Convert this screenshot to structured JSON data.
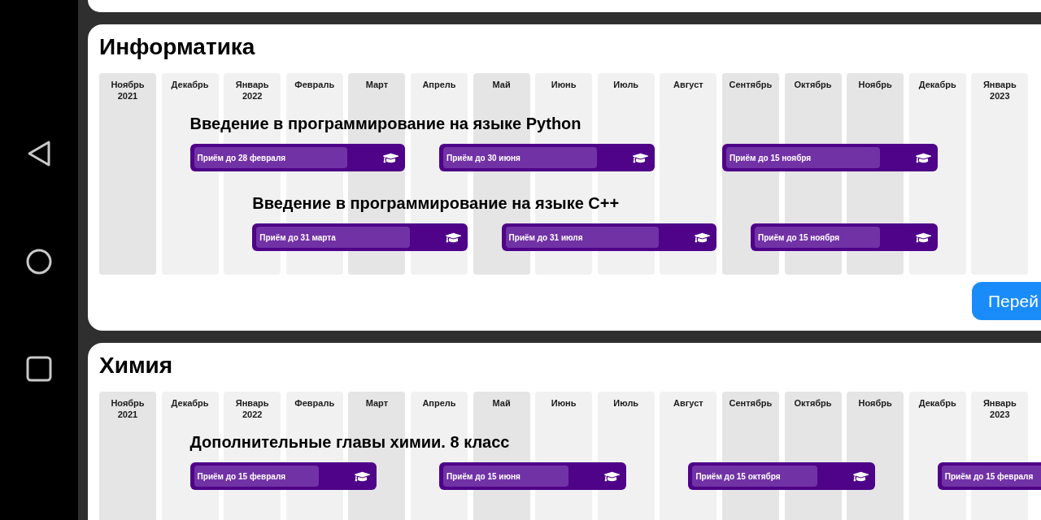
{
  "sections": [
    {
      "title": "Информатика",
      "months": [
        {
          "name": "Ноябрь",
          "year": "2021",
          "shaded": true
        },
        {
          "name": "Декабрь",
          "shaded": false
        },
        {
          "name": "Январь",
          "year": "2022",
          "shaded": false
        },
        {
          "name": "Февраль",
          "shaded": false
        },
        {
          "name": "Март",
          "shaded": true
        },
        {
          "name": "Апрель",
          "shaded": false
        },
        {
          "name": "Май",
          "shaded": true
        },
        {
          "name": "Июнь",
          "shaded": false
        },
        {
          "name": "Июль",
          "shaded": false
        },
        {
          "name": "Август",
          "shaded": false
        },
        {
          "name": "Сентябрь",
          "shaded": true
        },
        {
          "name": "Октябрь",
          "shaded": true
        },
        {
          "name": "Ноябрь",
          "shaded": true
        },
        {
          "name": "Декабрь",
          "shaded": false
        },
        {
          "name": "Январь",
          "year": "2023",
          "shaded": false
        }
      ],
      "courses": [
        {
          "title": "Введение в программирование на языке Python",
          "sessions": [
            {
              "label": "Приём до 28 февраля"
            },
            {
              "label": "Приём до 30 июня"
            },
            {
              "label": "Приём до 15 ноября"
            }
          ]
        },
        {
          "title": "Введение в программирование на языке C++",
          "sessions": [
            {
              "label": "Приём до 31 марта"
            },
            {
              "label": "Приём до 31 июля"
            },
            {
              "label": "Приём до 15 ноября"
            }
          ]
        }
      ],
      "action_button": {
        "label": "Перей"
      }
    },
    {
      "title": "Химия",
      "months": [
        {
          "name": "Ноябрь",
          "year": "2021",
          "shaded": true
        },
        {
          "name": "Декабрь",
          "shaded": false
        },
        {
          "name": "Январь",
          "year": "2022",
          "shaded": false
        },
        {
          "name": "Февраль",
          "shaded": false
        },
        {
          "name": "Март",
          "shaded": true
        },
        {
          "name": "Апрель",
          "shaded": false
        },
        {
          "name": "Май",
          "shaded": true
        },
        {
          "name": "Июнь",
          "shaded": false
        },
        {
          "name": "Июль",
          "shaded": false
        },
        {
          "name": "Август",
          "shaded": false
        },
        {
          "name": "Сентябрь",
          "shaded": true
        },
        {
          "name": "Октябрь",
          "shaded": true
        },
        {
          "name": "Ноябрь",
          "shaded": true
        },
        {
          "name": "Декабрь",
          "shaded": false
        },
        {
          "name": "Январь",
          "year": "2023",
          "shaded": false
        }
      ],
      "courses": [
        {
          "title": "Дополнительные главы химии. 8 класс",
          "sessions": [
            {
              "label": "Приём до 15 февраля"
            },
            {
              "label": "Приём до 15 июня"
            },
            {
              "label": "Приём до 15 октября"
            },
            {
              "label": "Приём до 15 февраля"
            }
          ]
        }
      ]
    }
  ]
}
